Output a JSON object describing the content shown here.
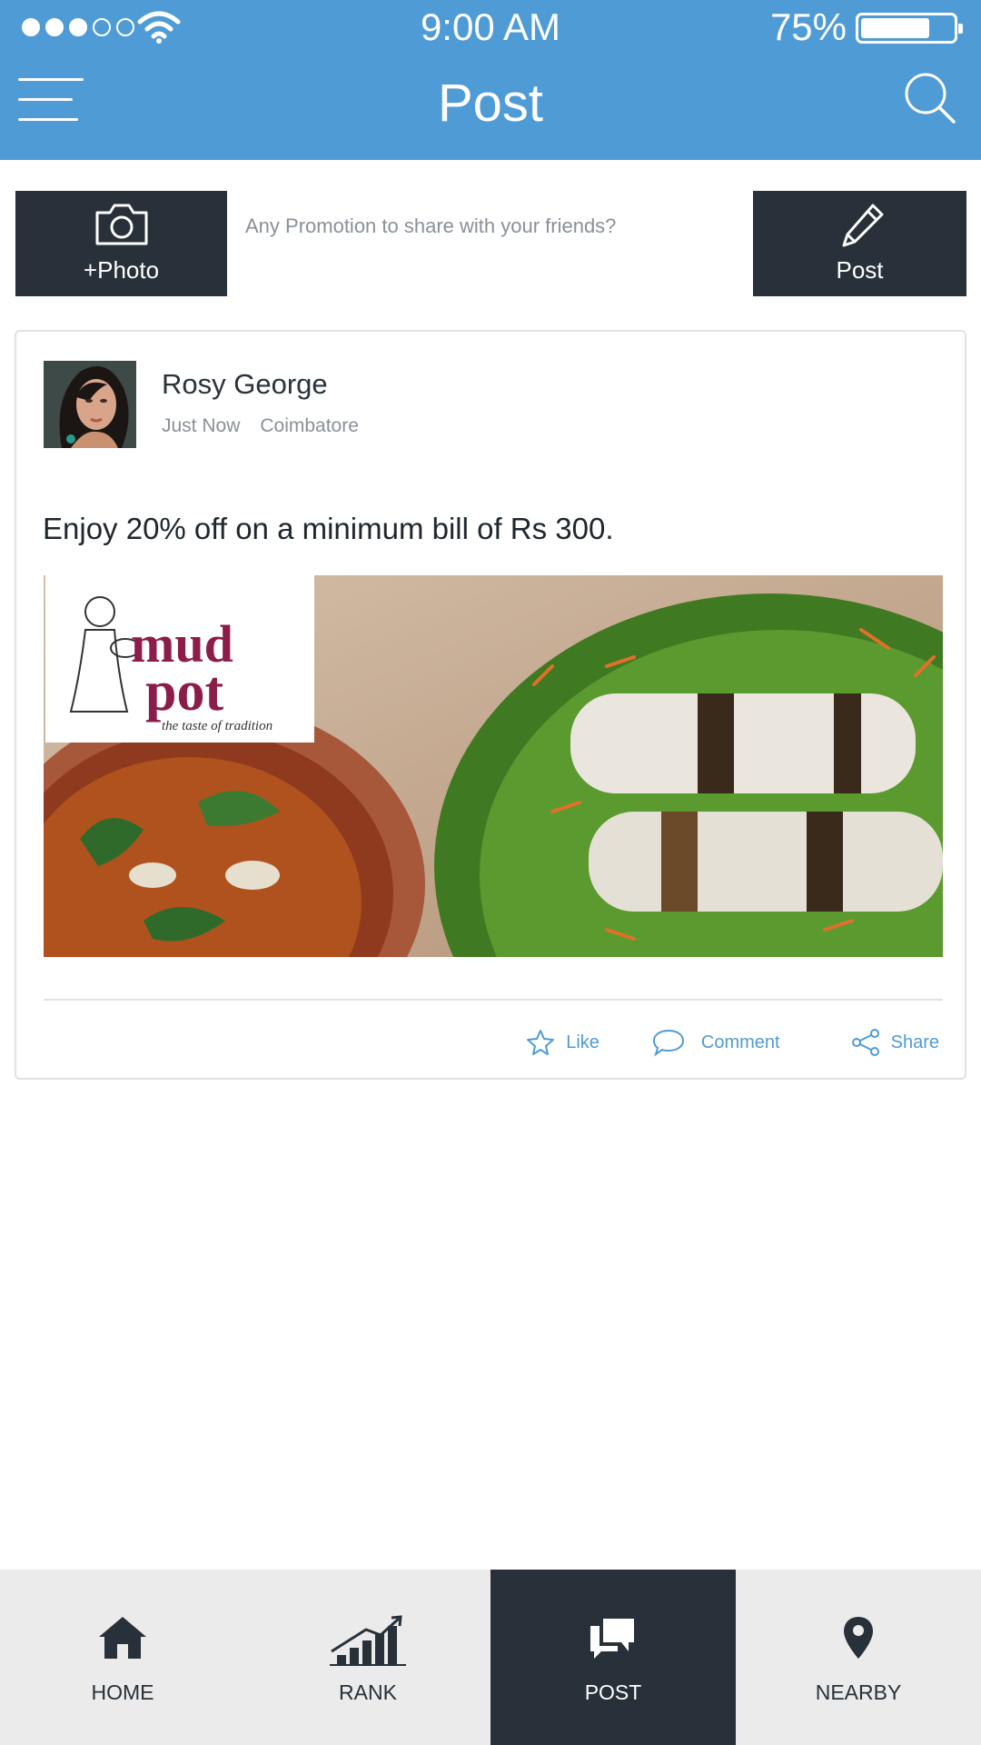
{
  "status_bar": {
    "signal_bars_filled": 3,
    "signal_bars_total": 5,
    "time": "9:00 AM",
    "battery_percent": "75%",
    "battery_level": 0.75
  },
  "header": {
    "title": "Post",
    "menu_icon": "hamburger-icon",
    "search_icon": "search-icon"
  },
  "composer": {
    "photo_label": "+Photo",
    "prompt_text": "Any Promotion to share with your friends?",
    "post_label": "Post"
  },
  "post": {
    "author": "Rosy George",
    "time": "Just Now",
    "location": "Coimbatore",
    "text": "Enjoy 20% off on a minimum bill of Rs 300.",
    "image_logo_text": "mud pot",
    "image_tagline": "the taste of tradition",
    "actions": {
      "like": "Like",
      "comment": "Comment",
      "share": "Share"
    }
  },
  "bottom_nav": {
    "items": [
      {
        "label": "HOME",
        "icon": "home-icon"
      },
      {
        "label": "RANK",
        "icon": "rank-chart-icon"
      },
      {
        "label": "POST",
        "icon": "chat-bubbles-icon",
        "active": true
      },
      {
        "label": "NEARBY",
        "icon": "map-pin-icon"
      }
    ]
  },
  "colors": {
    "primary": "#4f9bd5",
    "dark": "#283039",
    "nav_bg": "#ebebeb"
  }
}
